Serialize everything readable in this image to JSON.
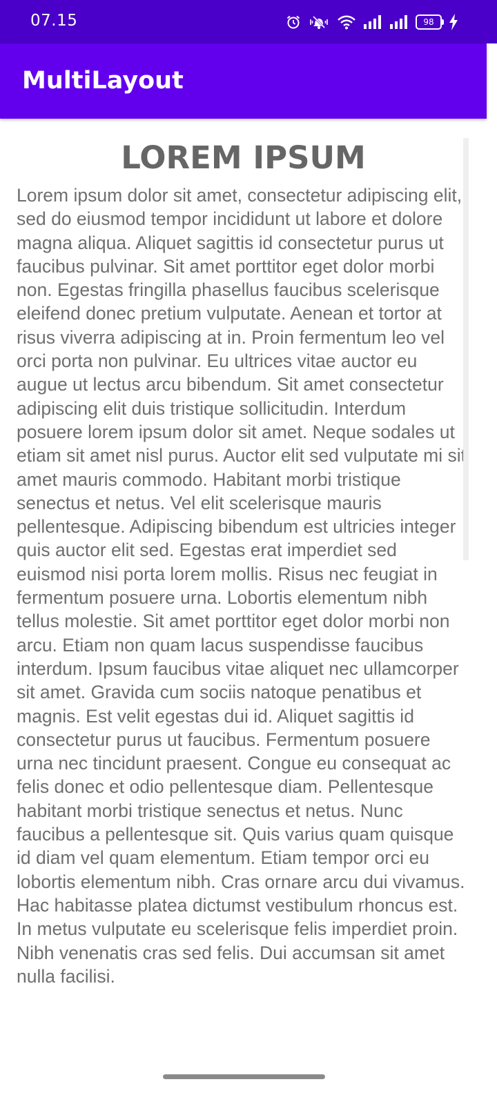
{
  "status_bar": {
    "time": "07.15",
    "battery_level": "98",
    "icons": [
      "alarm-icon",
      "vibrate-icon",
      "wifi-icon",
      "signal-icon",
      "signal-icon",
      "battery-icon",
      "charging-icon"
    ]
  },
  "app_bar": {
    "title": "MultiLayout"
  },
  "content": {
    "heading": "LOREM IPSUM",
    "body": "Lorem ipsum dolor sit amet, consectetur adipiscing elit, sed do eiusmod tempor incididunt ut labore et dolore magna aliqua. Aliquet sagittis id consectetur purus ut faucibus pulvinar. Sit amet porttitor eget dolor morbi non. Egestas fringilla phasellus faucibus scelerisque eleifend donec pretium vulputate. Aenean et tortor at risus viverra adipiscing at in. Proin fermentum leo vel orci porta non pulvinar. Eu ultrices vitae auctor eu augue ut lectus arcu bibendum. Sit amet consectetur adipiscing elit duis tristique sollicitudin. Interdum posuere lorem ipsum dolor sit amet. Neque sodales ut etiam sit amet nisl purus. Auctor elit sed vulputate mi sit amet mauris commodo. Habitant morbi tristique senectus et netus. Vel elit scelerisque mauris pellentesque. Adipiscing bibendum est ultricies integer quis auctor elit sed. Egestas erat imperdiet sed euismod nisi porta lorem mollis. Risus nec feugiat in fermentum posuere urna. Lobortis elementum nibh tellus molestie. Sit amet porttitor eget dolor morbi non arcu. Etiam non quam lacus suspendisse faucibus interdum. Ipsum faucibus vitae aliquet nec ullamcorper sit amet. Gravida cum sociis natoque penatibus et magnis. Est velit egestas dui id. Aliquet sagittis id consectetur purus ut faucibus. Fermentum posuere urna nec tincidunt praesent. Congue eu consequat ac felis donec et odio pellentesque diam. Pellentesque habitant morbi tristique senectus et netus. Nunc faucibus a pellentesque sit. Quis varius quam quisque id diam vel quam elementum. Etiam tempor orci eu lobortis elementum nibh. Cras ornare arcu dui vivamus. Hac habitasse platea dictumst vestibulum rhoncus est. In metus vulputate eu scelerisque felis imperdiet proin. Nibh venenatis cras sed felis. Dui accumsan sit amet nulla facilisi."
  },
  "colors": {
    "status_bar": "#4a00c8",
    "app_bar": "#6200ee",
    "heading_text": "#666666",
    "body_text": "#6f6f6f"
  }
}
